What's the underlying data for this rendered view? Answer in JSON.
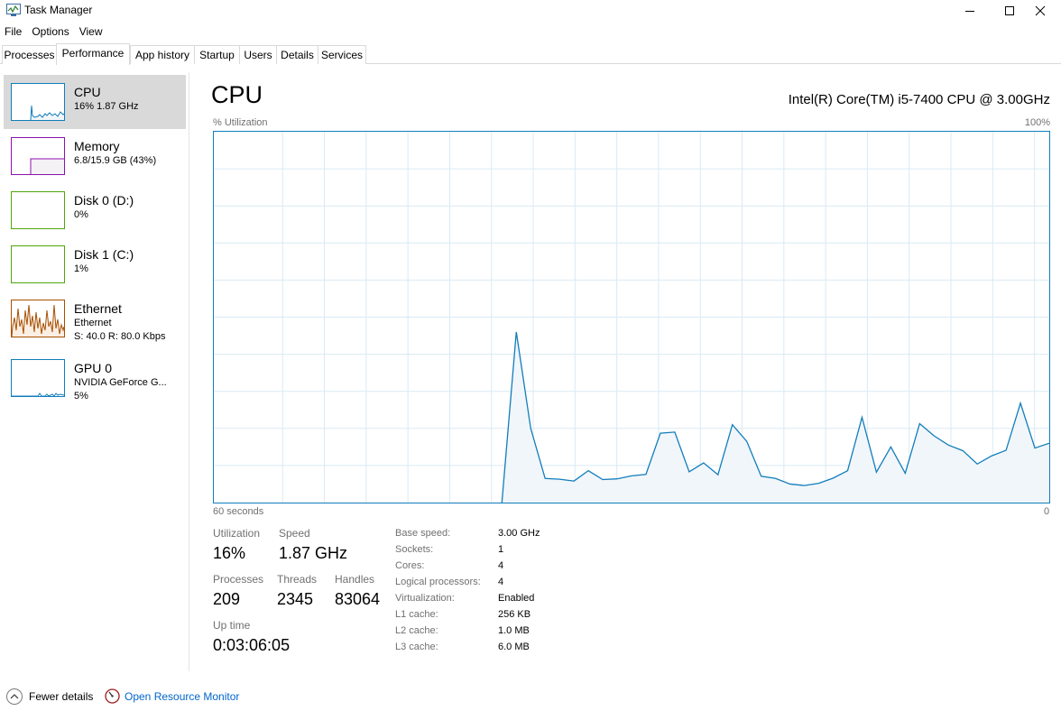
{
  "window": {
    "title": "Task Manager",
    "app_icon": "task-manager-icon",
    "controls": [
      "minimize-icon",
      "maximize-icon",
      "close-icon"
    ]
  },
  "menu": [
    "File",
    "Options",
    "View"
  ],
  "tabs": [
    "Processes",
    "Performance",
    "App history",
    "Startup",
    "Users",
    "Details",
    "Services"
  ],
  "active_tab": "Performance",
  "sidebar": [
    {
      "title": "CPU",
      "sub": "16% 1.87 GHz",
      "sub2": "",
      "color": "#117dbb",
      "selected": true
    },
    {
      "title": "Memory",
      "sub": "6.8/15.9 GB (43%)",
      "sub2": "",
      "color": "#8b12ae",
      "selected": false
    },
    {
      "title": "Disk 0 (D:)",
      "sub": "0%",
      "sub2": "",
      "color": "#4da60c",
      "selected": false
    },
    {
      "title": "Disk 1 (C:)",
      "sub": "1%",
      "sub2": "",
      "color": "#4da60c",
      "selected": false
    },
    {
      "title": "Ethernet",
      "sub": "Ethernet",
      "sub2": "S: 40.0  R: 80.0 Kbps",
      "color": "#a74f01",
      "selected": false
    },
    {
      "title": "GPU 0",
      "sub": "NVIDIA GeForce G...",
      "sub2": "5%",
      "color": "#117dbb",
      "selected": false
    }
  ],
  "main": {
    "title": "CPU",
    "model": "Intel(R) Core(TM) i5-7400 CPU @ 3.00GHz",
    "graph_label_top_left": "% Utilization",
    "graph_label_top_right": "100%",
    "graph_label_bottom_left": "60 seconds",
    "graph_label_bottom_right": "0",
    "graph_color": "#117dbb",
    "graph_fill": "#f1f6fa"
  },
  "chart_data": {
    "type": "area",
    "xlabel": "60 seconds",
    "ylabel": "% Utilization",
    "ylim": [
      0,
      100
    ],
    "x_range": [
      60,
      0
    ],
    "grid": true,
    "series": [
      {
        "values": [
          0,
          0,
          0,
          0,
          0,
          0,
          0,
          0,
          0,
          0,
          0,
          0,
          0,
          0,
          0,
          0,
          0,
          0,
          0,
          0,
          0,
          46,
          20,
          6.5,
          6.3,
          5.8,
          8.6,
          6.2,
          6.4,
          7.2,
          7.6,
          18.7,
          19,
          8.3,
          10.7,
          7.5,
          21,
          16.5,
          7.1,
          6.5,
          5,
          4.6,
          5.2,
          6.6,
          8.6,
          23,
          8.2,
          15,
          7.9,
          21.3,
          18,
          15.5,
          14,
          10.4,
          12.6,
          14.1,
          26.8,
          14.7,
          16
        ]
      }
    ]
  },
  "stats": {
    "utilization_label": "Utilization",
    "utilization": "16%",
    "speed_label": "Speed",
    "speed": "1.87 GHz",
    "processes_label": "Processes",
    "processes": "209",
    "threads_label": "Threads",
    "threads": "2345",
    "handles_label": "Handles",
    "handles": "83064",
    "uptime_label": "Up time",
    "uptime": "0:03:06:05"
  },
  "specs": [
    {
      "label": "Base speed:",
      "value": "3.00 GHz"
    },
    {
      "label": "Sockets:",
      "value": "1"
    },
    {
      "label": "Cores:",
      "value": "4"
    },
    {
      "label": "Logical processors:",
      "value": "4"
    },
    {
      "label": "Virtualization:",
      "value": "Enabled"
    },
    {
      "label": "L1 cache:",
      "value": "256 KB"
    },
    {
      "label": "L2 cache:",
      "value": "1.0 MB"
    },
    {
      "label": "L3 cache:",
      "value": "6.0 MB"
    }
  ],
  "footer": {
    "fewer_details": "Fewer details",
    "open_monitor": "Open Resource Monitor"
  }
}
